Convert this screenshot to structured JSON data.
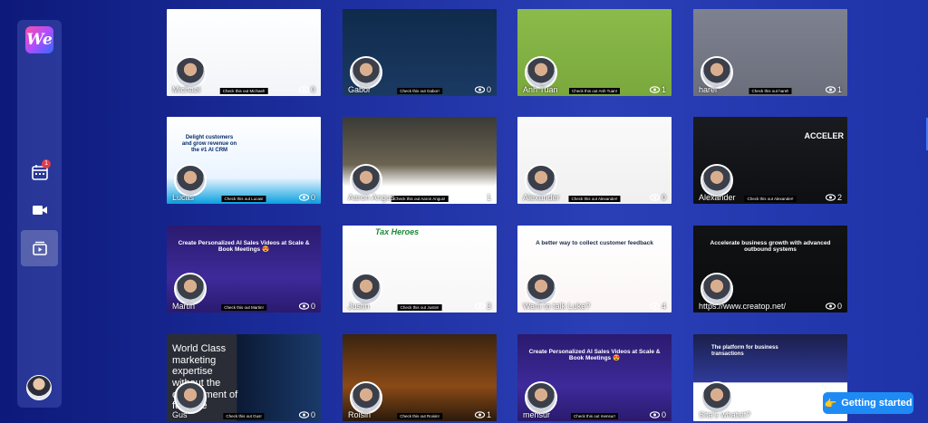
{
  "app": {
    "logo_text": "We"
  },
  "sidebar": {
    "items": [
      {
        "name": "calendar",
        "icon": "calendar-icon",
        "badge": "1"
      },
      {
        "name": "record",
        "icon": "video-camera-icon"
      },
      {
        "name": "library",
        "icon": "video-library-icon",
        "active": true
      }
    ]
  },
  "cards": [
    {
      "name": "Michael",
      "views": "0",
      "caption": "Check this out Michael!",
      "theme": "white",
      "headline": ""
    },
    {
      "name": "Gabor",
      "views": "0",
      "caption": "Check this out Gabor!",
      "theme": "navy",
      "headline": ""
    },
    {
      "name": "Anh Tuan",
      "views": "1",
      "caption": "Check this out Anh Tuan!",
      "theme": "green",
      "headline": ""
    },
    {
      "name": "harel",
      "views": "1",
      "caption": "Check this out harel!",
      "theme": "grey",
      "headline": ""
    },
    {
      "name": "Lucas",
      "views": "0",
      "caption": "Check this out Lucas!",
      "theme": "crm",
      "headline": "Delight customers and grow revenue on the #1 AI CRM"
    },
    {
      "name": "Aaron Angus",
      "views": "1",
      "caption": "Check this out Aaron Angus!",
      "theme": "office",
      "headline": ""
    },
    {
      "name": "Alexander",
      "views": "0",
      "caption": "Check this out Alexander!",
      "theme": "rope",
      "headline": ""
    },
    {
      "name": "Alexander",
      "views": "2",
      "caption": "Check this out Alexander!",
      "theme": "dark",
      "headline": "ACCELER"
    },
    {
      "name": "Martin",
      "views": "0",
      "caption": "Check this out Martin!",
      "theme": "purple",
      "headline": "Create Personalized AI Sales Videos at Scale & Book Meetings 😍"
    },
    {
      "name": "Justin",
      "views": "3",
      "caption": "Check this out Justin!",
      "theme": "tax",
      "headline": "Tax Heroes"
    },
    {
      "name": "Want to talk Luke?",
      "views": "4",
      "caption": "",
      "theme": "feedback",
      "headline": "A better way to collect customer feedback"
    },
    {
      "name": "https://www.creatop.net/",
      "views": "0",
      "caption": "",
      "theme": "black",
      "headline": "Accelerate business growth with advanced outbound systems"
    },
    {
      "name": "Gus",
      "views": "0",
      "caption": "Check this out Gus!",
      "theme": "earth",
      "headline": "World Class marketing expertise without the commitment of full-time"
    },
    {
      "name": "Roisin",
      "views": "1",
      "caption": "Check this out Roisin!",
      "theme": "orange",
      "headline": ""
    },
    {
      "name": "mensur",
      "views": "0",
      "caption": "Check this out mensur!",
      "theme": "purple",
      "headline": "Create Personalized AI Sales Videos at Scale & Book Meetings 😍"
    },
    {
      "name": "Sita's whatsit?",
      "views": "",
      "caption": "",
      "theme": "platform",
      "headline": "The platform for business transactions"
    }
  ],
  "getting_started": {
    "label": "Getting started"
  },
  "colors": {
    "accent": "#1e8bf5",
    "bg": "#1d2e9e"
  }
}
